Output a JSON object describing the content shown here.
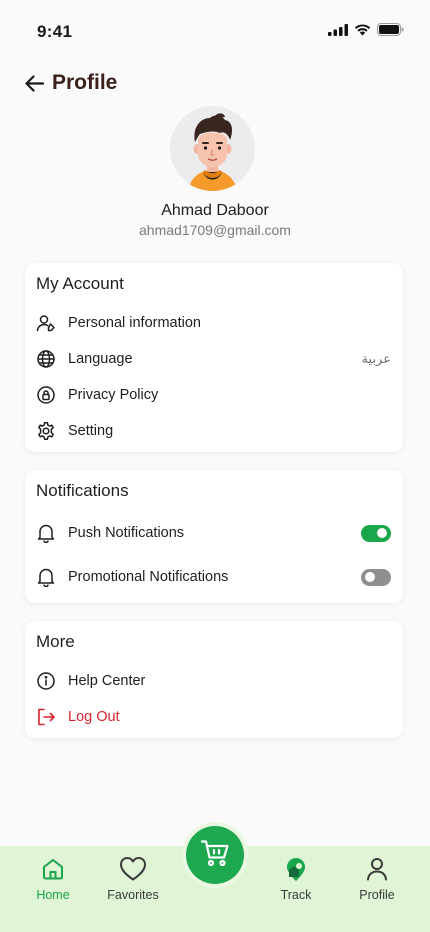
{
  "status_bar": {
    "time": "9:41"
  },
  "header": {
    "title": "Profile"
  },
  "profile": {
    "name": "Ahmad Daboor",
    "email": "ahmad1709@gmail.com"
  },
  "account": {
    "title": "My Account",
    "items": [
      {
        "label": "Personal information",
        "icon": "user-edit-icon"
      },
      {
        "label": "Language",
        "icon": "globe-icon",
        "value": "عربية"
      },
      {
        "label": "Privacy Policy",
        "icon": "shield-lock-icon"
      },
      {
        "label": "Setting",
        "icon": "gear-icon"
      }
    ]
  },
  "notifications": {
    "title": "Notifications",
    "items": [
      {
        "label": "Push Notifications",
        "icon": "bell-icon",
        "enabled": true
      },
      {
        "label": "Promotional Notifications",
        "icon": "bell-icon",
        "enabled": false
      }
    ]
  },
  "more": {
    "title": "More",
    "items": [
      {
        "label": "Help Center",
        "icon": "info-icon"
      },
      {
        "label": "Log Out",
        "icon": "logout-icon"
      }
    ]
  },
  "tabbar": {
    "items": [
      {
        "label": "Home",
        "icon": "home-icon",
        "active": true
      },
      {
        "label": "Favorites",
        "icon": "heart-icon",
        "active": false
      },
      {
        "label": "Track",
        "icon": "location-icon",
        "active": false
      },
      {
        "label": "Profile",
        "icon": "user-icon",
        "active": false
      }
    ],
    "center_icon": "cart-icon"
  },
  "colors": {
    "accent": "#1aa64b",
    "danger": "#d9232e",
    "tabbar_bg": "#dff5d6",
    "title_brown": "#3b1f1a"
  }
}
